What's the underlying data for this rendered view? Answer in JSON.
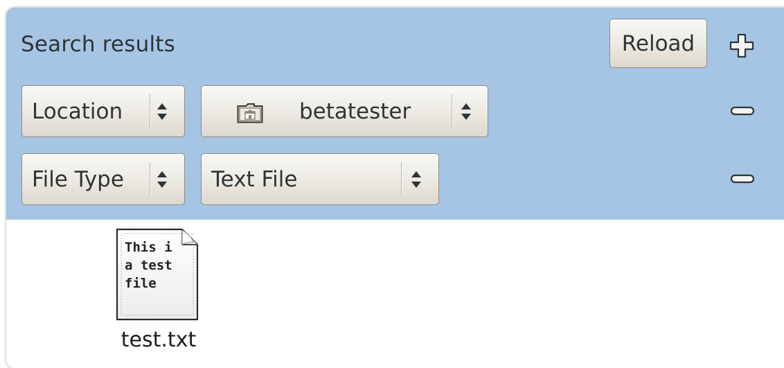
{
  "search": {
    "title": "Search results",
    "reload_label": "Reload"
  },
  "criteria": [
    {
      "type_label": "Location",
      "value_label": "betatester",
      "value_icon": "home-folder-icon"
    },
    {
      "type_label": "File Type",
      "value_label": "Text File"
    }
  ],
  "results": {
    "files": [
      {
        "name": "test.txt",
        "preview_lines": [
          "This i",
          "a test",
          "file"
        ]
      }
    ]
  },
  "colors": {
    "search_bar_bg": "#a6c5e4",
    "results_bg": "#ffffff"
  }
}
